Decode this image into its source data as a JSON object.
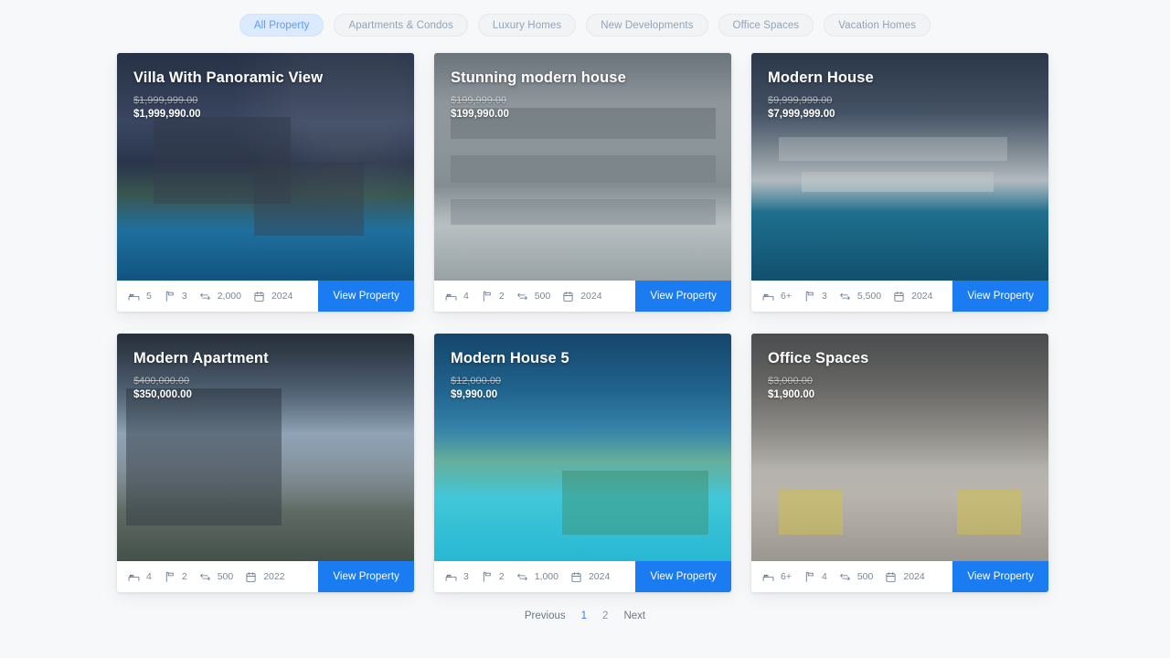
{
  "filters": [
    {
      "label": "All Property",
      "active": true
    },
    {
      "label": "Apartments & Condos",
      "active": false
    },
    {
      "label": "Luxury Homes",
      "active": false
    },
    {
      "label": "New Developments",
      "active": false
    },
    {
      "label": "Office Spaces",
      "active": false
    },
    {
      "label": "Vacation Homes",
      "active": false
    }
  ],
  "cta_label": "View Property",
  "colors": {
    "accent_blue": "#1a7cf0",
    "active_pill_bg": "#dbeafe",
    "active_pill_text": "#5b9bf5",
    "page_bg": "#f7f8f9",
    "card_bg": "#ffffff"
  },
  "icons": {
    "bed": "bed-icon",
    "bath": "bath-icon",
    "area": "area-icon",
    "year": "calendar-icon"
  },
  "properties": [
    {
      "title": "Villa With Panoramic View",
      "price_old": "$1,999,999.00",
      "price_new": "$1,999,990.00",
      "beds": "5",
      "baths": "3",
      "area": "2,000",
      "year": "2024",
      "cta": "View Property",
      "theme": "ph-villa"
    },
    {
      "title": "Stunning modern house",
      "price_old": "$199,999.00",
      "price_new": "$199,990.00",
      "beds": "4",
      "baths": "2",
      "area": "500",
      "year": "2024",
      "cta": "View Property",
      "theme": "ph-stunning"
    },
    {
      "title": "Modern House",
      "price_old": "$9,999,999.00",
      "price_new": "$7,999,999.00",
      "beds": "6+",
      "baths": "3",
      "area": "5,500",
      "year": "2024",
      "cta": "View Property",
      "theme": "ph-modern"
    },
    {
      "title": "Modern Apartment",
      "price_old": "$400,000.00",
      "price_new": "$350,000.00",
      "beds": "4",
      "baths": "2",
      "area": "500",
      "year": "2022",
      "cta": "View Property",
      "theme": "ph-apartment"
    },
    {
      "title": "Modern House 5",
      "price_old": "$12,000.00",
      "price_new": "$9,990.00",
      "beds": "3",
      "baths": "2",
      "area": "1,000",
      "year": "2024",
      "cta": "View Property",
      "theme": "ph-house5"
    },
    {
      "title": "Office Spaces",
      "price_old": "$3,000.00",
      "price_new": "$1,900.00",
      "beds": "6+",
      "baths": "4",
      "area": "500",
      "year": "2024",
      "cta": "View Property",
      "theme": "ph-office"
    }
  ],
  "pagination": {
    "previous": "Previous",
    "next": "Next",
    "pages": [
      {
        "label": "1",
        "active": true
      },
      {
        "label": "2",
        "active": false
      }
    ]
  }
}
